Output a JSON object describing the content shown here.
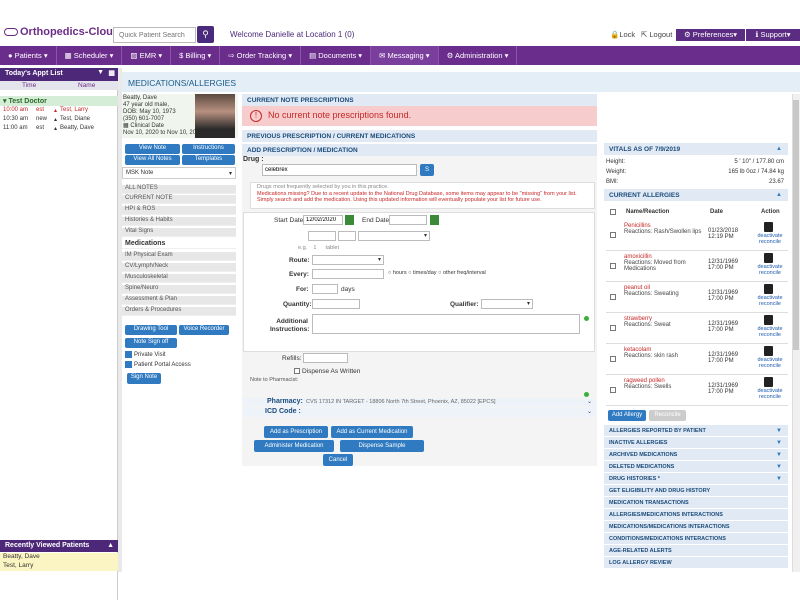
{
  "app": {
    "logo": "Orthopedics-Cloud",
    "search_placeholder": "Quick Patient Search",
    "welcome": "Welcome Danielle at Location 1 (0)",
    "lock": "Lock",
    "logout": "Logout",
    "preferences": "Preferences",
    "support": "Support"
  },
  "nav": [
    "Patients",
    "Scheduler",
    "EMR",
    "Billing",
    "Order Tracking",
    "Documents",
    "Messaging",
    "Administration"
  ],
  "left": {
    "appt_title": "Today's Appt List",
    "cols": {
      "time": "Time",
      "name": "Name"
    },
    "doctor": "Test Doctor",
    "appts": [
      {
        "time": "10:00 am",
        "type": "est",
        "name": "Test, Larry",
        "red": true
      },
      {
        "time": "10:30 am",
        "type": "new",
        "name": "Test, Diane",
        "red": false
      },
      {
        "time": "11:00 am",
        "type": "est",
        "name": "Beatty, Dave",
        "red": false
      }
    ],
    "recent_title": "Recently Viewed Patients",
    "recent": [
      "Beatty, Dave",
      "Test, Larry"
    ]
  },
  "main": {
    "title": "MEDICATIONS/ALLERGIES",
    "patient": {
      "name": "Beatty, Dave",
      "age": "47 year old male,",
      "dob": "DOB: May 10, 1973",
      "phone": "(350) 601-7007",
      "clinical_label": "Clinical Date",
      "clinical_date": "Nov 10, 2020 to Nov 10, 2020"
    },
    "buttons": {
      "view_note": "View Note",
      "instructions": "Instructions",
      "view_all": "View All Notes",
      "templates": "Templates",
      "drawing": "Drawing Tool",
      "voice": "Voice Recorder",
      "signoff": "Note Sign off",
      "sign": "Sign Note"
    },
    "note_select": "MSK Note",
    "menu": [
      "ALL NOTES",
      "CURRENT NOTE",
      "HPI & ROS",
      "Histories & Habits",
      "Vital Signs"
    ],
    "menu_head": "Medications",
    "menu2": [
      "IM Physical Exam",
      "CV/Lymph/Neck",
      "Musculoskeletal",
      "Spine/Neuro",
      "Assessment & Plan",
      "Orders & Procedures"
    ],
    "checks": {
      "private": "Private Visit",
      "portal": "Patient Portal Access"
    },
    "sections": {
      "current": "CURRENT NOTE PRESCRIPTIONS",
      "previous": "PREVIOUS PRESCRIPTION / CURRENT MEDICATIONS",
      "add": "ADD PRESCRIPTION / MEDICATION"
    },
    "alert": "No current note prescriptions found.",
    "form": {
      "drug_label": "Drug :",
      "drug_value": "celebrex",
      "search_btn": "S",
      "hint": "Drugs most frequently selected by you in this practice.",
      "missing1": "Medications missing? Due to a recent update to the National Drug Database, some items may appear to be \"missing\" from your list.",
      "missing2": "Simply search and add the medication. Using this updated information will eventually populate your list for future use.",
      "start_label": "Start Date:",
      "start_value": "12/02/2020",
      "end_label": "End Date:",
      "eg": "e.g.",
      "eg_num": "1",
      "eg_unit": "tablet",
      "route": "Route:",
      "every": "Every:",
      "freq": [
        "hours",
        "times/day",
        "other freq/interval"
      ],
      "for": "For:",
      "days": "days",
      "quantity": "Quantity:",
      "qualifier": "Qualifier:",
      "instructions": "Additional Instructions:",
      "refills": "Refills:",
      "dispense": "Dispense As Written",
      "pharm_note": "Note to Pharmacist:",
      "pharmacy_label": "Pharmacy:",
      "pharmacy_value": "CVS 17312 IN TARGET - 18806 North 7th Street, Phoenix, AZ, 85022 [EPCS]",
      "icd_label": "ICD Code :",
      "btn_add_rx": "Add as Prescription",
      "btn_add_med": "Add as Current Medication",
      "btn_admin": "Administer Medication",
      "btn_dispense": "Dispense Sample",
      "btn_cancel": "Cancel"
    }
  },
  "right": {
    "vitals_title": "VITALS AS OF 7/9/2019",
    "vitals": [
      {
        "label": "Height:",
        "value": "5 ' 10\" / 177.80 cm"
      },
      {
        "label": "Weight:",
        "value": "165 lb 0oz / 74.84 kg"
      },
      {
        "label": "BMI:",
        "value": "23.67"
      }
    ],
    "allergies_title": "CURRENT ALLERGIES",
    "cols": {
      "name": "Name/Reaction",
      "date": "Date",
      "action": "Action"
    },
    "allergies": [
      {
        "name": "Penicillins",
        "reaction": "Reactions: Rash/Swollen lips",
        "date": "01/23/2018",
        "time": "12:19 PM"
      },
      {
        "name": "amoxicillin",
        "reaction": "Reactions: Moved from Medications",
        "date": "12/31/1969",
        "time": "17:00 PM"
      },
      {
        "name": "peanut oil",
        "reaction": "Reactions: Sweating",
        "date": "12/31/1969",
        "time": "17:00 PM"
      },
      {
        "name": "strawberry",
        "reaction": "Reactions: Sweat",
        "date": "12/31/1969",
        "time": "17:00 PM"
      },
      {
        "name": "ketacolam",
        "reaction": "Reactions: skin rash",
        "date": "12/31/1969",
        "time": "17:00 PM"
      },
      {
        "name": "ragweed pollen",
        "reaction": "Reactions: Swells",
        "date": "12/31/1969",
        "time": "17:00 PM"
      }
    ],
    "deactivate": "deactivate",
    "reconcile": "reconcile",
    "add_allergy": "Add Allergy",
    "reconcile_btn": "Reconcile",
    "bars": [
      "ALLERGIES REPORTED BY PATIENT",
      "INACTIVE ALLERGIES",
      "ARCHIVED MEDICATIONS",
      "DELETED MEDICATIONS",
      "DRUG HISTORIES *",
      "GET ELIGIBILITY AND DRUG HISTORY",
      "MEDICATION TRANSACTIONS",
      "ALLERGIES/MEDICATIONS INTERACTIONS",
      "MEDICATIONS/MEDICATIONS INTERACTIONS",
      "CONDITIONS/MEDICATIONS INTERACTIONS",
      "AGE-RELATED ALERTS",
      "LOG ALLERGY REVIEW"
    ]
  }
}
